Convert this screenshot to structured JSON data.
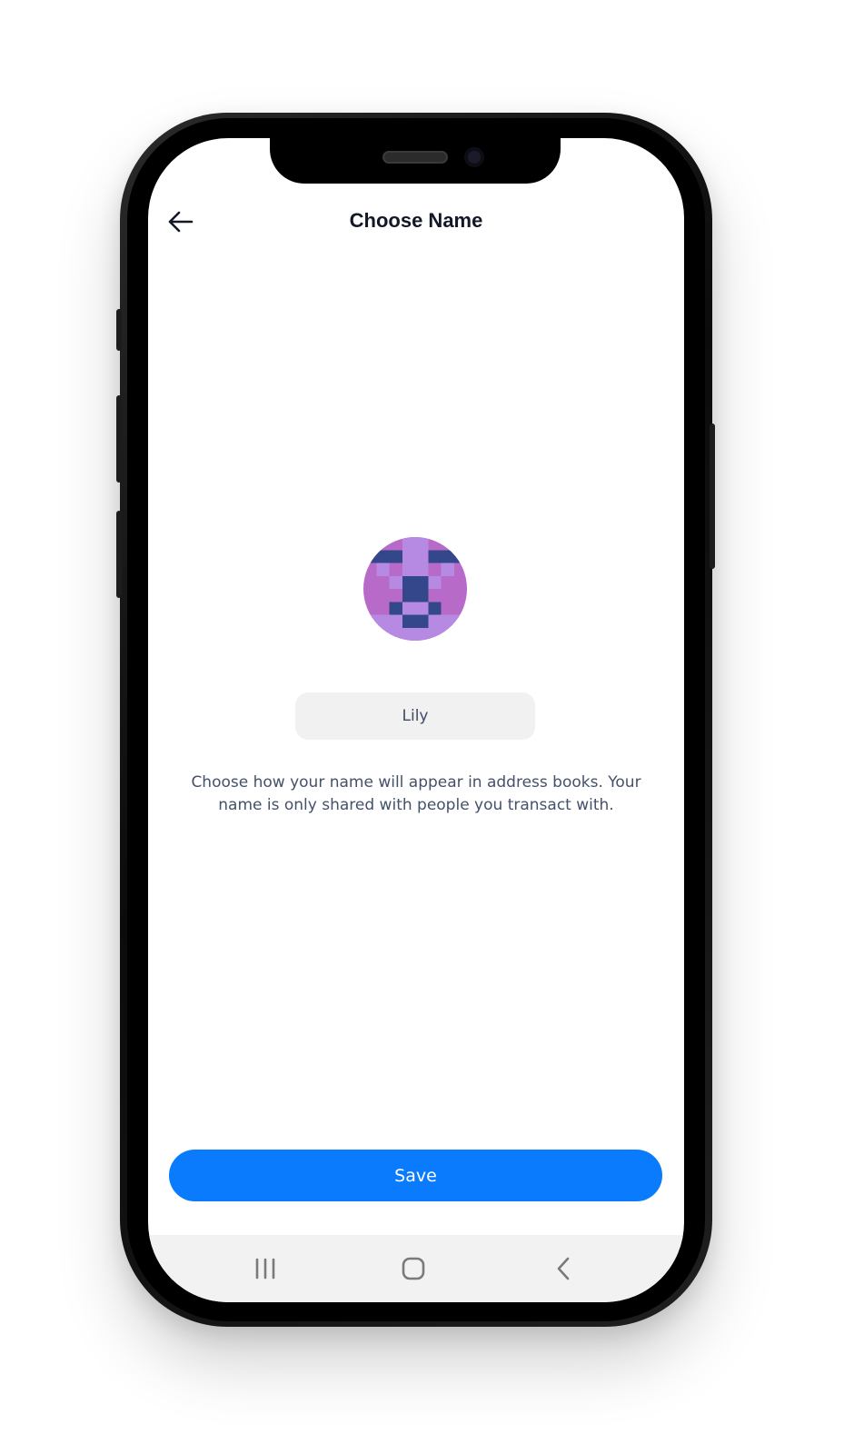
{
  "header": {
    "title": "Choose Name",
    "back_icon": "arrow-left-icon"
  },
  "avatar": {
    "icon": "identicon-avatar",
    "colors": {
      "background": "#b86ac8",
      "light": "#b68ae2",
      "dark": "#34478a"
    }
  },
  "name_field": {
    "value": "Lily"
  },
  "description": "Choose how your name will appear in address books. Your name is only shared with people you transact with.",
  "actions": {
    "save_label": "Save",
    "save_color": "#0a7bfd"
  },
  "system_nav": {
    "recents_icon": "recents-icon",
    "home_icon": "home-icon",
    "back_icon": "chevron-left-icon"
  }
}
